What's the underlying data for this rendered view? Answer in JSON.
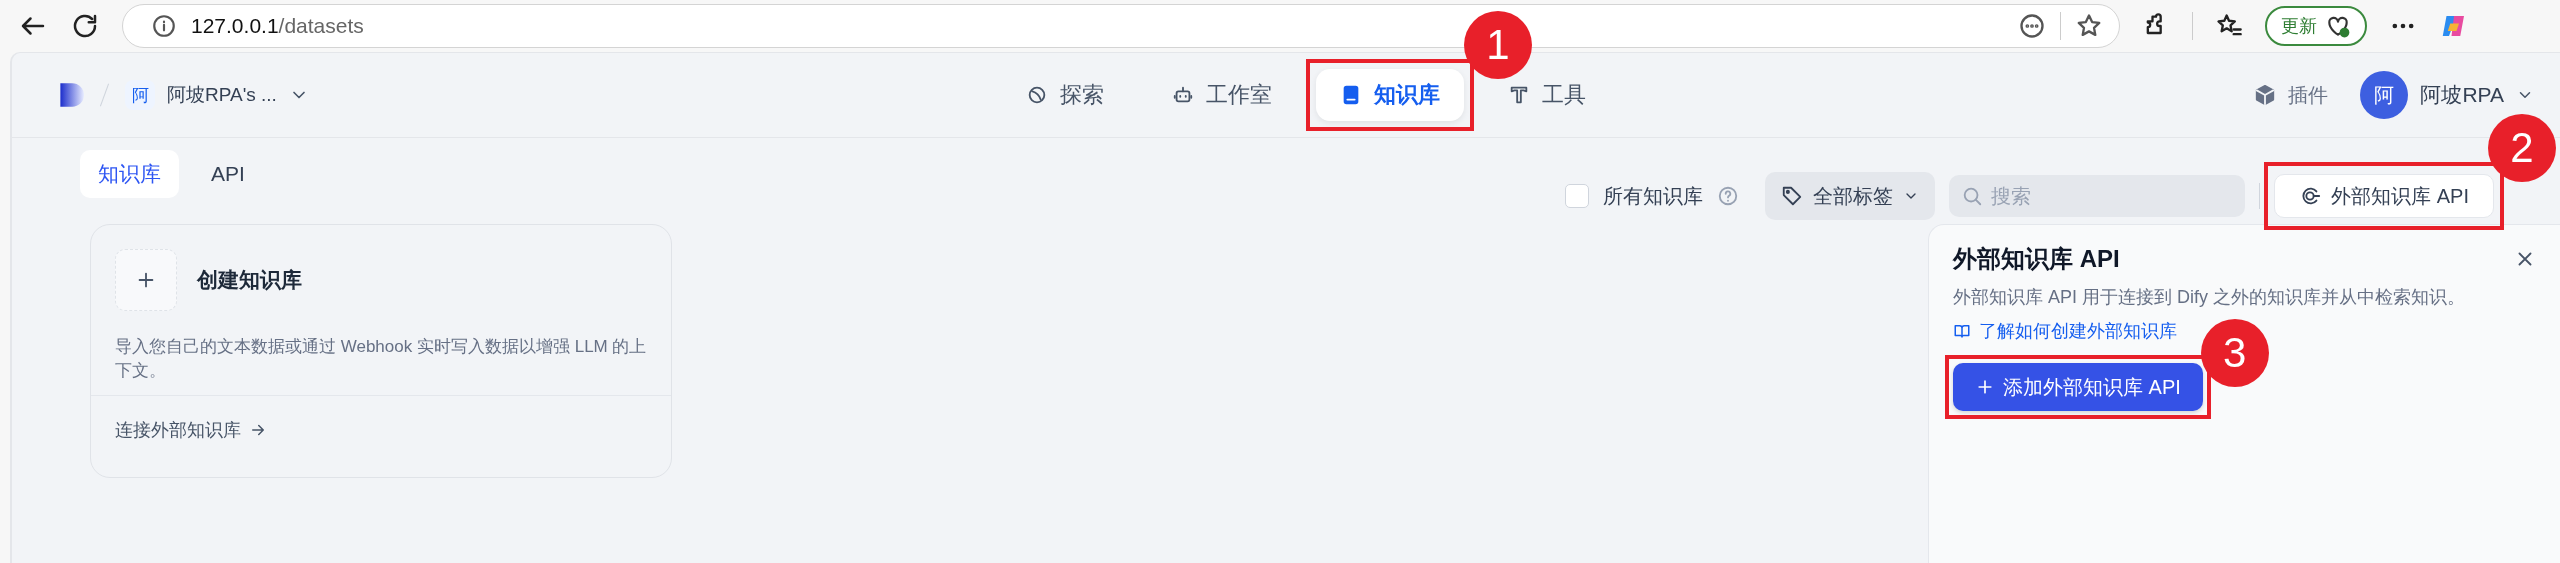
{
  "browser": {
    "url_host": "127.0.0.1",
    "url_path": "/datasets",
    "update_button": "更新"
  },
  "header": {
    "workspace": {
      "avatar": "阿",
      "name": "阿坡RPA's ..."
    },
    "nav": [
      {
        "label": "探索",
        "selected": false
      },
      {
        "label": "工作室",
        "selected": false
      },
      {
        "label": "知识库",
        "selected": true
      },
      {
        "label": "工具",
        "selected": false
      }
    ],
    "plugins": "插件",
    "user": {
      "avatar": "阿",
      "name": "阿坡RPA"
    }
  },
  "subtabs": [
    {
      "label": "知识库",
      "selected": true
    },
    {
      "label": "API",
      "selected": false
    }
  ],
  "filters": {
    "all_label": "所有知识库",
    "all_checked": false,
    "tags": "全部标签",
    "search_placeholder": "搜索",
    "external_api_button": "外部知识库 API"
  },
  "create_card": {
    "title": "创建知识库",
    "description": "导入您自己的文本数据或通过 Webhook 实时写入数据以增强 LLM 的上下文。",
    "footer_link": "连接外部知识库"
  },
  "panel": {
    "title": "外部知识库 API",
    "description": "外部知识库 API 用于连接到 Dify 之外的知识库并从中检索知识。",
    "link": "了解如何创建外部知识库",
    "add_button": "添加外部知识库 API"
  },
  "annotations": [
    {
      "label": "1"
    },
    {
      "label": "2"
    },
    {
      "label": "3"
    }
  ]
}
